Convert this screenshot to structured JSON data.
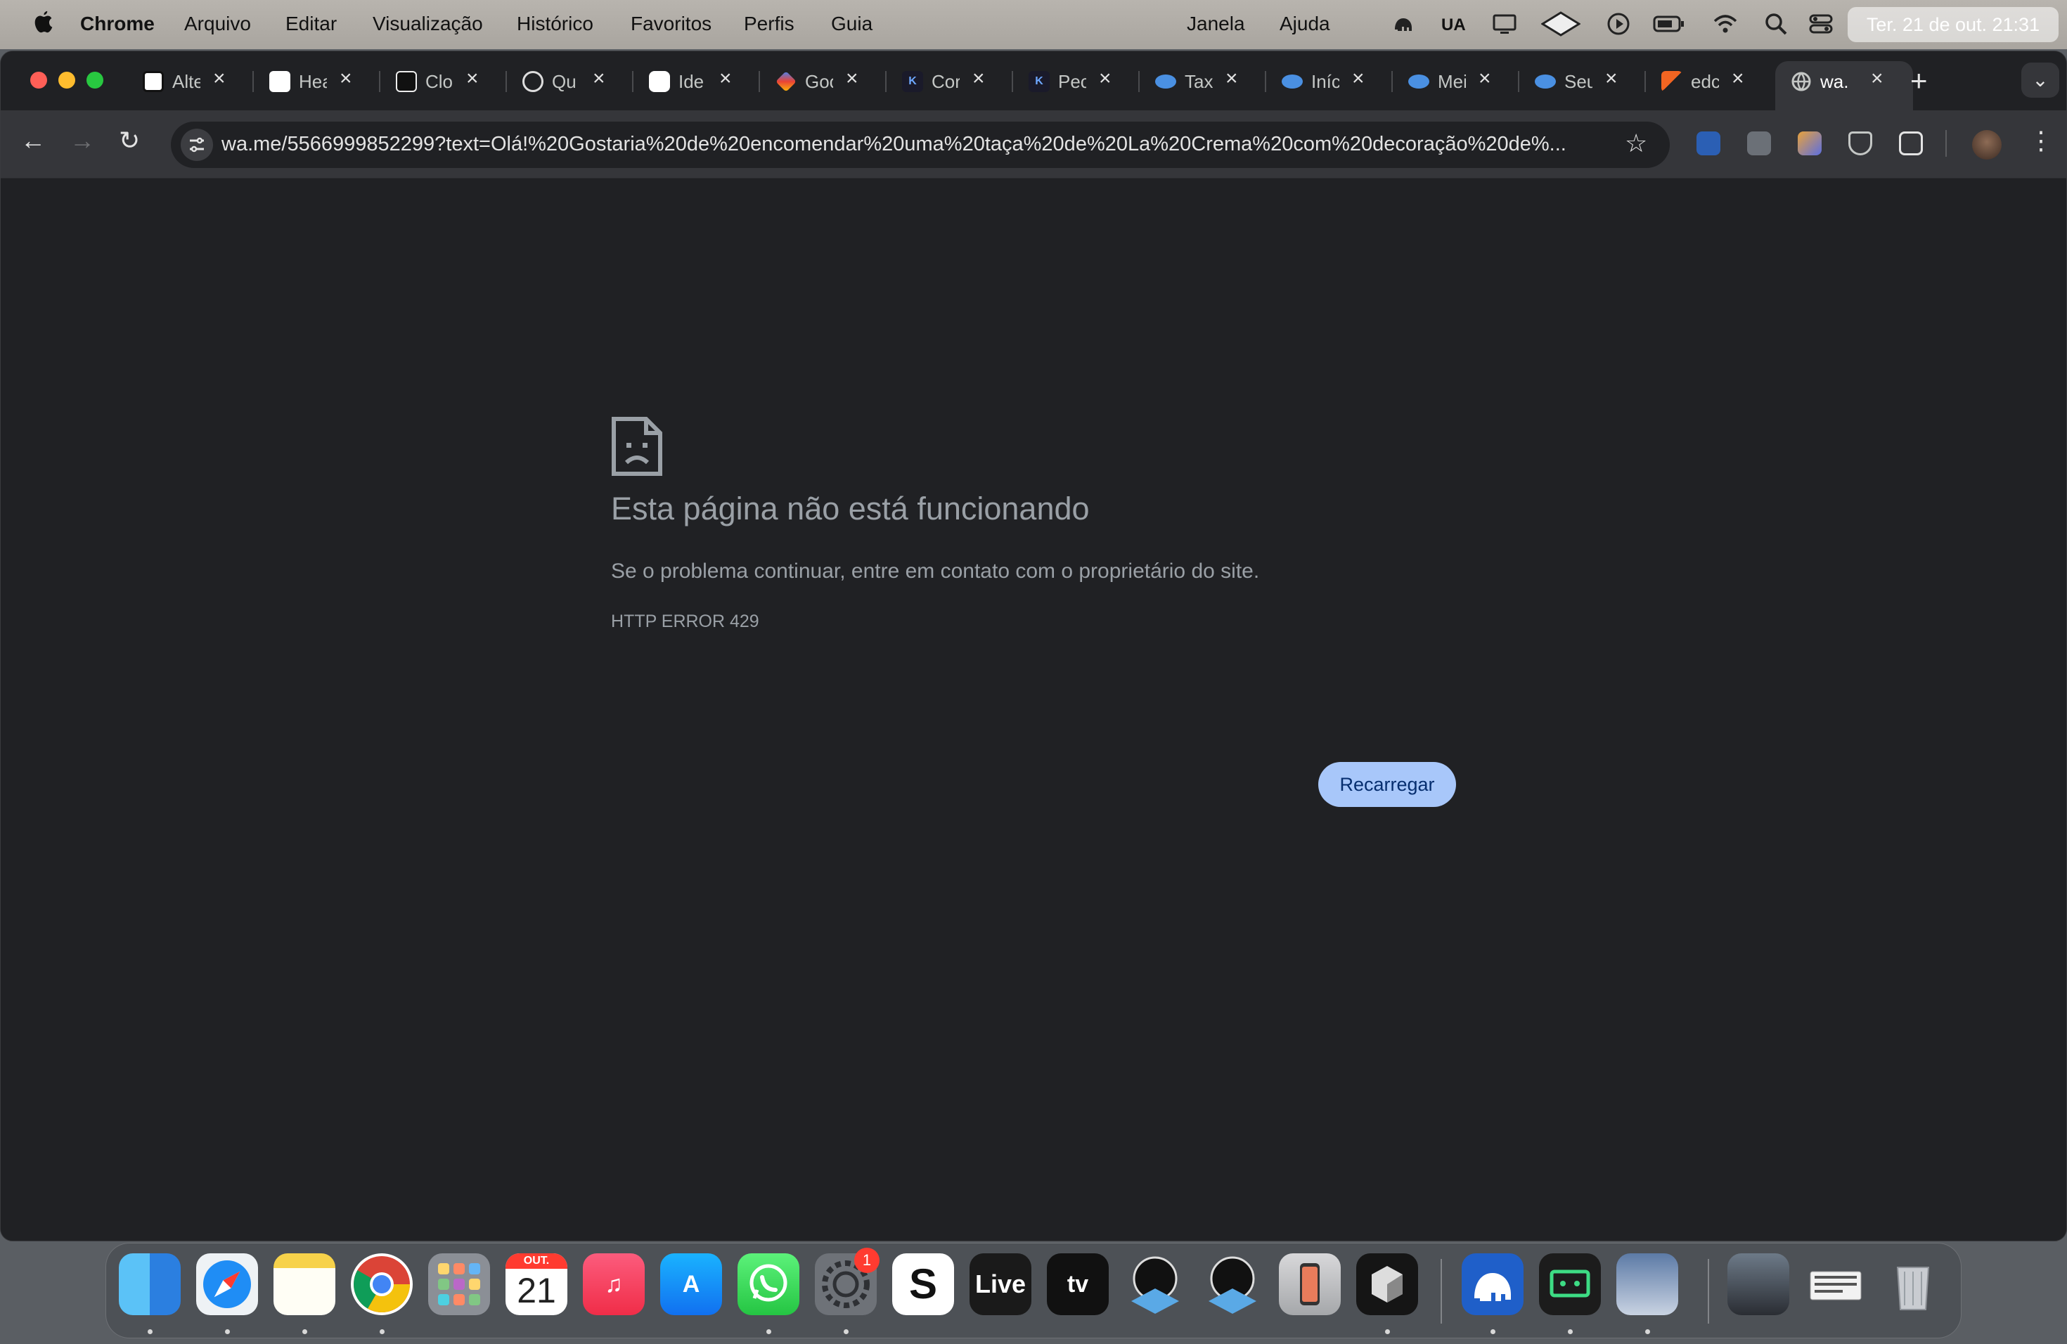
{
  "menubar": {
    "app_name": "Chrome",
    "menus": [
      "Arquivo",
      "Editar",
      "Visualização",
      "Histórico",
      "Favoritos",
      "Perfis",
      "Guia"
    ],
    "right_menus": [
      "Janela",
      "Ajuda"
    ],
    "ua_label": "UA",
    "clock": "Ter. 21 de out. 21:31"
  },
  "tabs": [
    {
      "title": "Alte",
      "icon": "notion-icon"
    },
    {
      "title": "Hea",
      "icon": "home-icon"
    },
    {
      "title": "Clo",
      "icon": "clo-icon"
    },
    {
      "title": "Qu",
      "icon": "openai-icon"
    },
    {
      "title": "Ide",
      "icon": "openai-icon"
    },
    {
      "title": "Goo",
      "icon": "gemini-icon"
    },
    {
      "title": "Cor",
      "icon": "k-icon"
    },
    {
      "title": "Pec",
      "icon": "k-icon"
    },
    {
      "title": "Tax",
      "icon": "eye-icon"
    },
    {
      "title": "Iníc",
      "icon": "eye-icon"
    },
    {
      "title": "Mei",
      "icon": "eye-icon"
    },
    {
      "title": "Seu",
      "icon": "eye-icon"
    },
    {
      "title": "edc",
      "icon": "edc-icon"
    },
    {
      "title": "wa.",
      "icon": "globe-icon",
      "active": true
    }
  ],
  "toolbar": {
    "url": "wa.me/5566999852299?text=Olá!%20Gostaria%20de%20encomendar%20uma%20taça%20de%20La%20Crema%20com%20decoração%20de%..."
  },
  "error_page": {
    "title": "Esta página não está funcionando",
    "description": "Se o problema continuar, entre em contato com o proprietário do site.",
    "code": "HTTP ERROR 429",
    "reload_label": "Recarregar"
  },
  "dock": {
    "calendar_month": "OUT.",
    "calendar_day": "21",
    "live_label": "Live",
    "tv_label": "tv",
    "settings_badge": "1"
  },
  "colors": {
    "page_bg": "#202124",
    "button_bg": "#a8c7fa",
    "text_muted": "#9aa0a6"
  }
}
